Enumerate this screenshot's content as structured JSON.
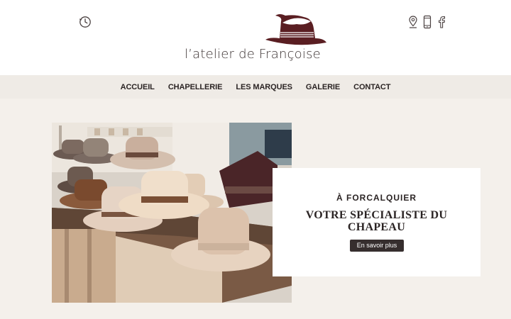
{
  "brand": {
    "name": "l’atelier de Françoise",
    "accent_color": "#5a1e22"
  },
  "header": {
    "left_icon": "clock-icon",
    "right_icons": [
      "map-pin-icon",
      "phone-icon",
      "facebook-icon"
    ]
  },
  "nav": {
    "items": [
      {
        "label": "ACCUEIL"
      },
      {
        "label": "CHAPELLERIE"
      },
      {
        "label": "LES MARQUES"
      },
      {
        "label": "GALERIE"
      },
      {
        "label": "CONTACT"
      }
    ]
  },
  "hero": {
    "image": "photo of felt fedora hats displayed on a wooden table in a shop",
    "kicker": "À FORCALQUIER",
    "title": "VOTRE SPÉCIALISTE DU CHAPEAU",
    "cta_label": "En savoir plus"
  }
}
